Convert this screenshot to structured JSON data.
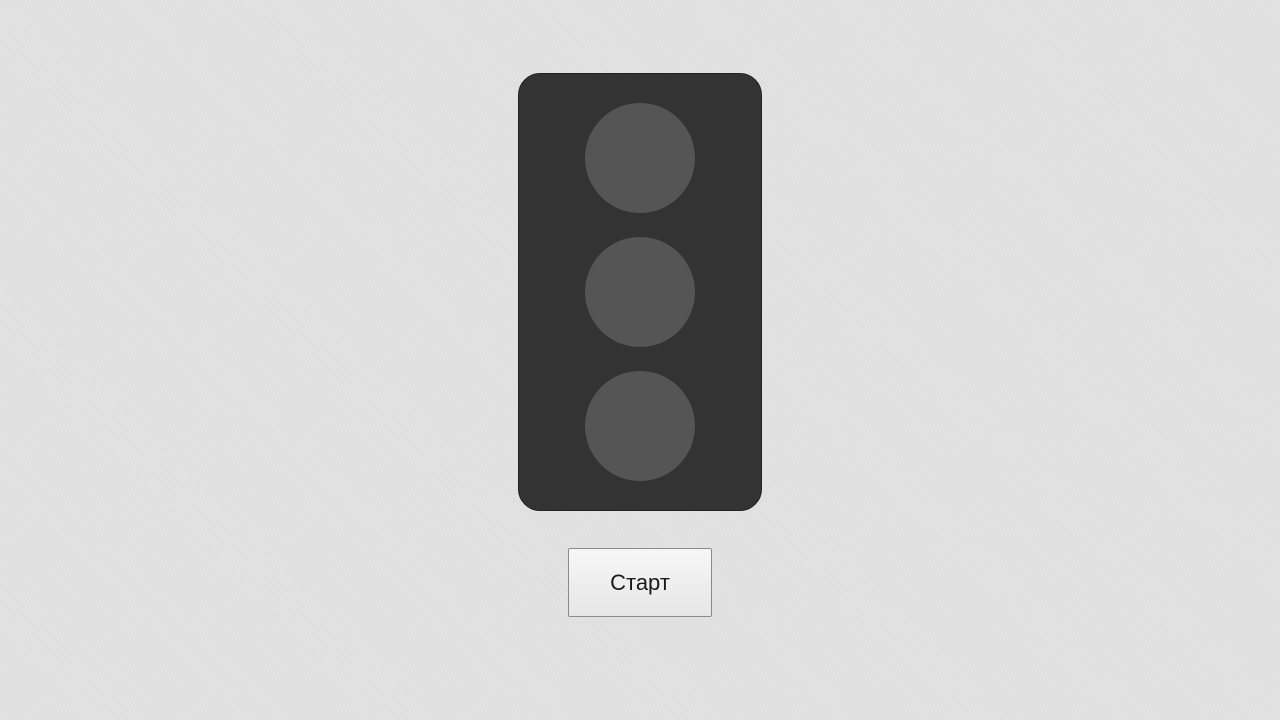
{
  "traffic_light": {
    "lamps": [
      {
        "position": "top",
        "state": "off",
        "color": "#555555"
      },
      {
        "position": "middle",
        "state": "off",
        "color": "#555555"
      },
      {
        "position": "bottom",
        "state": "off",
        "color": "#555555"
      }
    ],
    "housing_color": "#333333"
  },
  "controls": {
    "start_label": "Старт"
  },
  "background_color": "#e2e2e2"
}
